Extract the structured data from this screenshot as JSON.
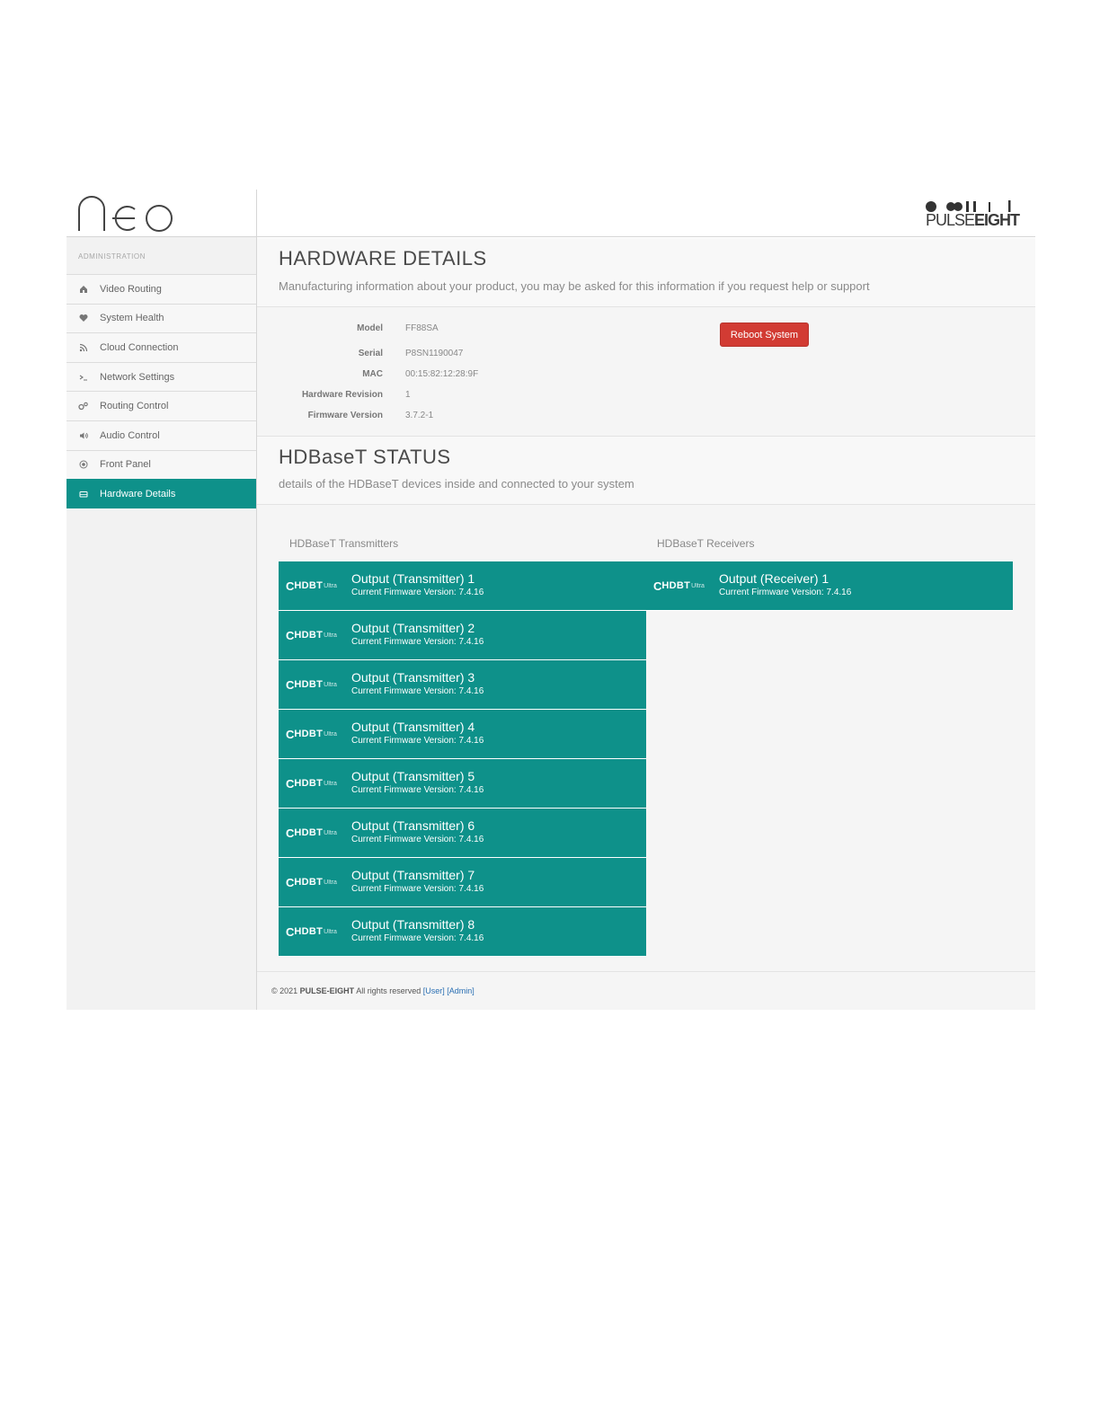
{
  "logo": {
    "text": "neo"
  },
  "brand": {
    "part1": "PULSE",
    "part2": "EIGHT"
  },
  "sidebar": {
    "section_label": "ADMINISTRATION",
    "items": [
      {
        "label": "Video Routing",
        "icon": "home-icon"
      },
      {
        "label": "System Health",
        "icon": "heart-icon"
      },
      {
        "label": "Cloud Connection",
        "icon": "rss-icon"
      },
      {
        "label": "Network Settings",
        "icon": "terminal-icon"
      },
      {
        "label": "Routing Control",
        "icon": "gears-icon"
      },
      {
        "label": "Audio Control",
        "icon": "volume-icon"
      },
      {
        "label": "Front Panel",
        "icon": "target-icon"
      },
      {
        "label": "Hardware Details",
        "icon": "hdd-icon",
        "active": true
      }
    ]
  },
  "hardware": {
    "title": "HARDWARE DETAILS",
    "subtitle": "Manufacturing information about your product, you may be asked for this information if you request help or support",
    "fields": [
      {
        "label": "Model",
        "value": "FF88SA"
      },
      {
        "label": "Serial",
        "value": "P8SN1190047"
      },
      {
        "label": "MAC",
        "value": "00:15:82:12:28:9F"
      },
      {
        "label": "Hardware Revision",
        "value": "1"
      },
      {
        "label": "Firmware Version",
        "value": "3.7.2-1"
      }
    ],
    "reboot_label": "Reboot System"
  },
  "hdbaset": {
    "title": "HDBaseT STATUS",
    "subtitle": "details of the HDBaseT devices inside and connected to your system",
    "transmitters_title": "HDBaseT Transmitters",
    "receivers_title": "HDBaseT Receivers",
    "logo_c": "C",
    "logo_text": "HDBT",
    "logo_ultra": "Ultra",
    "transmitters": [
      {
        "name": "Output (Transmitter) 1",
        "firmware": "Current Firmware Version: 7.4.16"
      },
      {
        "name": "Output (Transmitter) 2",
        "firmware": "Current Firmware Version: 7.4.16"
      },
      {
        "name": "Output (Transmitter) 3",
        "firmware": "Current Firmware Version: 7.4.16"
      },
      {
        "name": "Output (Transmitter) 4",
        "firmware": "Current Firmware Version: 7.4.16"
      },
      {
        "name": "Output (Transmitter) 5",
        "firmware": "Current Firmware Version: 7.4.16"
      },
      {
        "name": "Output (Transmitter) 6",
        "firmware": "Current Firmware Version: 7.4.16"
      },
      {
        "name": "Output (Transmitter) 7",
        "firmware": "Current Firmware Version: 7.4.16"
      },
      {
        "name": "Output (Transmitter) 8",
        "firmware": "Current Firmware Version: 7.4.16"
      }
    ],
    "receivers": [
      {
        "name": "Output (Receiver) 1",
        "firmware": "Current Firmware Version: 7.4.16"
      }
    ]
  },
  "footer": {
    "copyright": "© 2021",
    "company": "PULSE-EIGHT",
    "rights": "All rights reserved",
    "user_link": "[User]",
    "admin_link": "[Admin]"
  },
  "colors": {
    "accent": "#0e918a",
    "danger": "#d23b33",
    "link": "#2a6fb3"
  }
}
